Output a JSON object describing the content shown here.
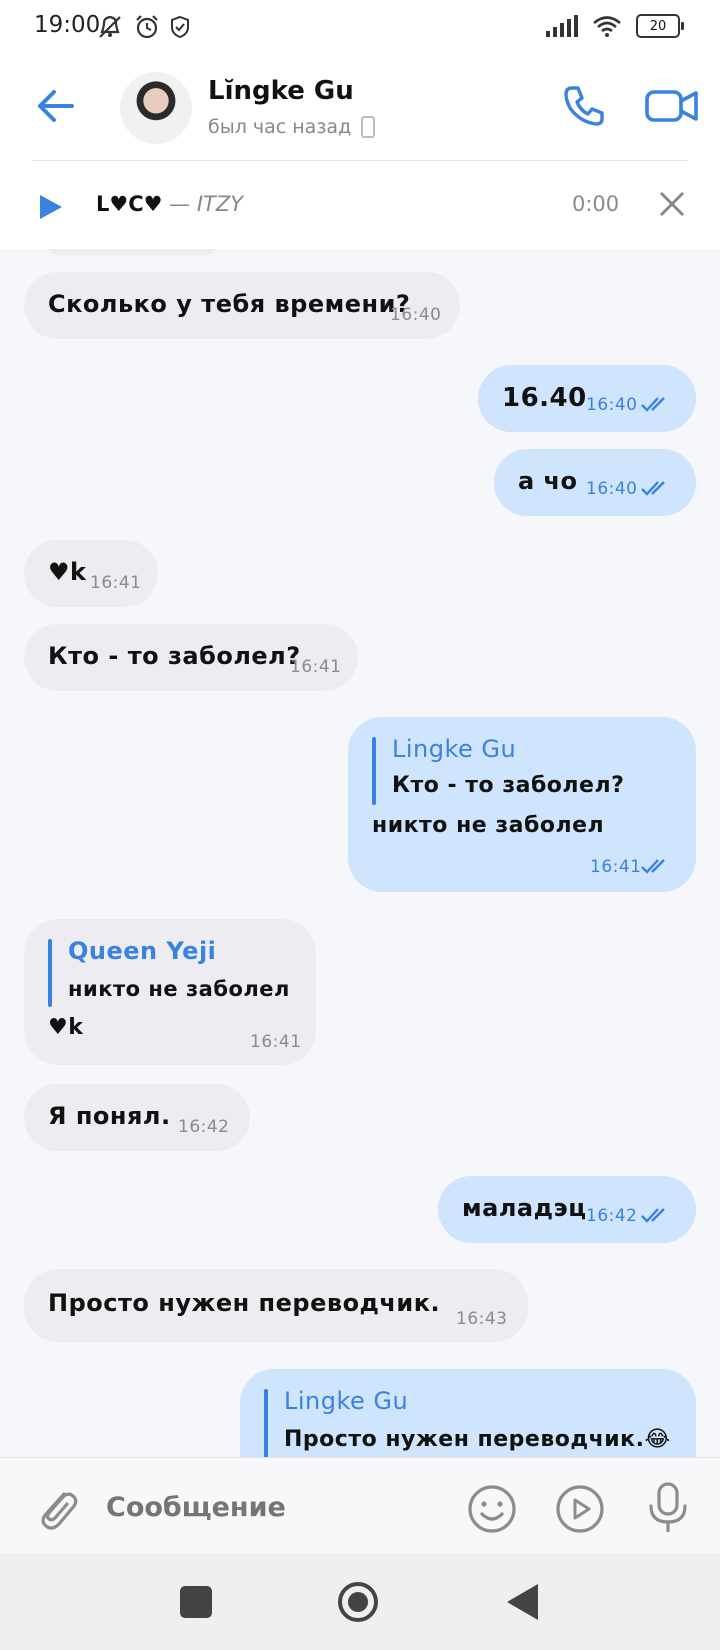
{
  "status_bar": {
    "time": "19:00",
    "battery": "20",
    "icons": [
      "mute-icon",
      "alarm-icon",
      "shield-icon",
      "signal-icon",
      "wifi-icon",
      "battery-icon"
    ]
  },
  "header": {
    "contact_name": "Lĭngke Gu",
    "last_seen": "был час назад"
  },
  "music": {
    "track": "L♥C♥",
    "separator": " — ",
    "artist": "ITZY",
    "time": "0:00"
  },
  "messages": [
    {
      "dir": "in",
      "text": "Сколько у тебя времени?",
      "time": "16:40"
    },
    {
      "dir": "out",
      "text": "16.40",
      "time": "16:40"
    },
    {
      "dir": "out",
      "text": "а чо",
      "time": "16:40"
    },
    {
      "dir": "in",
      "text": "♥k",
      "time": "16:41"
    },
    {
      "dir": "in",
      "text": "Кто - то заболел?",
      "time": "16:41"
    },
    {
      "dir": "out",
      "reply_name": "Lingke Gu",
      "reply_text": "Кто - то заболел?",
      "text": "никто не заболел",
      "time": "16:41"
    },
    {
      "dir": "in",
      "reply_name": "Queen Yeji",
      "reply_text": "никто не заболел",
      "text": "♥k",
      "time": "16:41"
    },
    {
      "dir": "in",
      "text": "Я понял.",
      "time": "16:42"
    },
    {
      "dir": "out",
      "text": "маладэц",
      "time": "16:42"
    },
    {
      "dir": "in",
      "text": "Просто нужен переводчик.",
      "time": "16:43"
    },
    {
      "dir": "out",
      "reply_name": "Lingke Gu",
      "reply_text": "Просто нужен переводчик.😂"
    }
  ],
  "input": {
    "placeholder": "Сообщение"
  },
  "colors": {
    "accent": "#3a82e0",
    "incoming_bubble": "#ececf1",
    "outgoing_bubble": "#cfe4fd"
  }
}
